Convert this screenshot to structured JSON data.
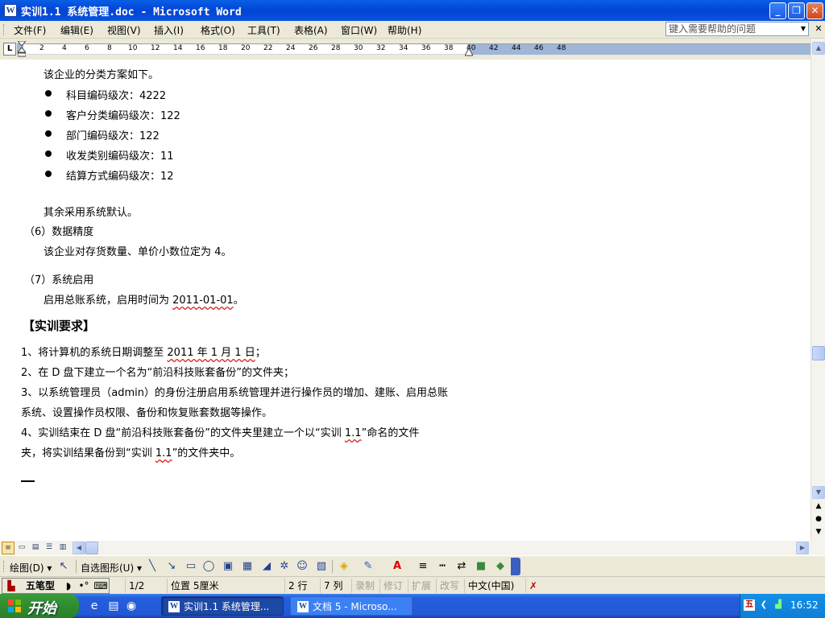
{
  "window": {
    "title": "实训1.1 系统管理.doc - Microsoft Word",
    "icon": "word-doc-icon",
    "controls": [
      "minimize-icon",
      "restore-icon",
      "close-icon"
    ]
  },
  "menu": {
    "items": [
      "文件(F)",
      "编辑(E)",
      "视图(V)",
      "插入(I)",
      "格式(O)",
      "工具(T)",
      "表格(A)",
      "窗口(W)",
      "帮助(H)"
    ],
    "help_placeholder": "键入需要帮助的问题"
  },
  "ruler": {
    "numbers": [
      "2",
      "4",
      "6",
      "8",
      "10",
      "12",
      "14",
      "16",
      "18",
      "20",
      "22",
      "24",
      "26",
      "28",
      "30",
      "32",
      "34",
      "36",
      "38",
      "40",
      "42",
      "44",
      "46",
      "48"
    ]
  },
  "document": {
    "intro": "该企业的分类方案如下。",
    "bullets": [
      "科目编码级次：4222",
      "客户分类编码级次：122",
      "部门编码级次：122",
      "收发类别编码级次：11",
      "结算方式编码级次：12"
    ],
    "default_note": "其余采用系统默认。",
    "sec6_title": "（6）数据精度",
    "sec6_body": "该企业对存货数量、单价小数位定为 4。",
    "sec7_title": "（7）系统启用",
    "sec7_body_prefix": "启用总账系统，启用时间为 ",
    "sec7_body_date": "2011-01-01",
    "sec7_body_suffix": "。",
    "req_heading": "【实训要求】",
    "req1_a": "1、将计算机的系统日期调整至 ",
    "req1_b": "2011 年 1 月 1 日",
    "req1_c": "；",
    "req2": "2、在 D 盘下建立一个名为“前沿科技账套备份”的文件夹；",
    "req3_line1": "3、以系统管理员（admin）的身份注册启用系统管理并进行操作员的增加、建账、启用总账",
    "req3_line2": "系统、设置操作员权限、备份和恢复账套数据等操作。",
    "req4_line1_a": "4、实训结束在 D 盘“前沿科技账套备份”的文件夹里建立一个以“实训 ",
    "req4_line1_b": "1.1",
    "req4_line1_c": "”命名的文件",
    "req4_line2_a": "夹，将实训结果备份到“实训 ",
    "req4_line2_b": "1.1",
    "req4_line2_c": "”的文件夹中。"
  },
  "drawing_toolbar": {
    "draw_label": "绘图(D)",
    "autoshapes_label": "自选图形(U)"
  },
  "status": {
    "ime_name": "五笔型",
    "page": "1/2",
    "position": "位置 5厘米",
    "row": "2 行",
    "col": "7 列",
    "rec": "录制",
    "trk": "修订",
    "ext": "扩展",
    "ovr": "改写",
    "language": "中文(中国)"
  },
  "taskbar": {
    "start_label": "开始",
    "tasks": [
      "实训1.1 系统管理...",
      "文档 5 - Microso..."
    ],
    "clock": "16:52"
  }
}
